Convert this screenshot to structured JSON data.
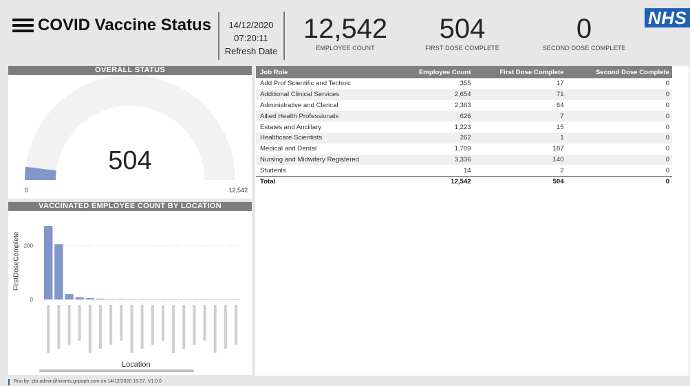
{
  "header": {
    "title": "COVID Vaccine Status",
    "refresh_date": "14/12/2020",
    "refresh_time": "07:20:11",
    "refresh_label": "Refresh Date",
    "logo_text": "NHS"
  },
  "kpis": {
    "employee_count": {
      "value": "12,542",
      "caption": "EMPLOYEE COUNT"
    },
    "first_dose": {
      "value": "504",
      "caption": "FIRST DOSE COMPLETE"
    },
    "second_dose": {
      "value": "0",
      "caption": "SECOND DOSE COMPLETE"
    }
  },
  "overall_status": {
    "title": "OVERALL STATUS",
    "value_label": "504",
    "min_label": "0",
    "max_label": "12,542",
    "value": 504,
    "max": 12542,
    "fill_color": "#8196c9",
    "track_color": "#f2f2f2"
  },
  "location_chart": {
    "title": "VACCINATED EMPLOYEE COUNT BY LOCATION",
    "ylabel": "FirstDoseComplete",
    "xlabel": "Location",
    "yticks": [
      "200",
      "0"
    ]
  },
  "chart_data": {
    "type": "bar",
    "values": [
      272,
      205,
      20,
      8,
      5,
      3,
      2,
      2,
      1,
      1,
      1,
      1,
      1,
      1,
      1,
      1,
      1,
      1,
      1
    ],
    "ylabel": "FirstDoseComplete",
    "xlabel": "Location",
    "ylim": [
      0,
      290
    ],
    "bar_color": "#8196c9"
  },
  "job_table": {
    "headers": [
      "Job Role",
      "Employee Count",
      "First Dose Complete",
      "Second Dose Complete"
    ],
    "rows": [
      [
        "Add Prof Scientific and Technic",
        "355",
        "17",
        "0"
      ],
      [
        "Additional Clinical Services",
        "2,654",
        "71",
        "0"
      ],
      [
        "Administrative and Clerical",
        "2,363",
        "64",
        "0"
      ],
      [
        "Allied Health Professionals",
        "626",
        "7",
        "0"
      ],
      [
        "Estates and Ancillary",
        "1,223",
        "15",
        "0"
      ],
      [
        "Healthcare Scientists",
        "262",
        "1",
        "0"
      ],
      [
        "Medical and Dental",
        "1,709",
        "187",
        "0"
      ],
      [
        "Nursing and Midwifery Registered",
        "3,336",
        "140",
        "0"
      ],
      [
        "Students",
        "14",
        "2",
        "0"
      ]
    ],
    "total": [
      "Total",
      "12,542",
      "504",
      "0"
    ]
  },
  "footer": {
    "text": "Run by: pbi.admin@nimms.gnpoph.com on 14/12/2020 15:57. V1.0.0"
  }
}
